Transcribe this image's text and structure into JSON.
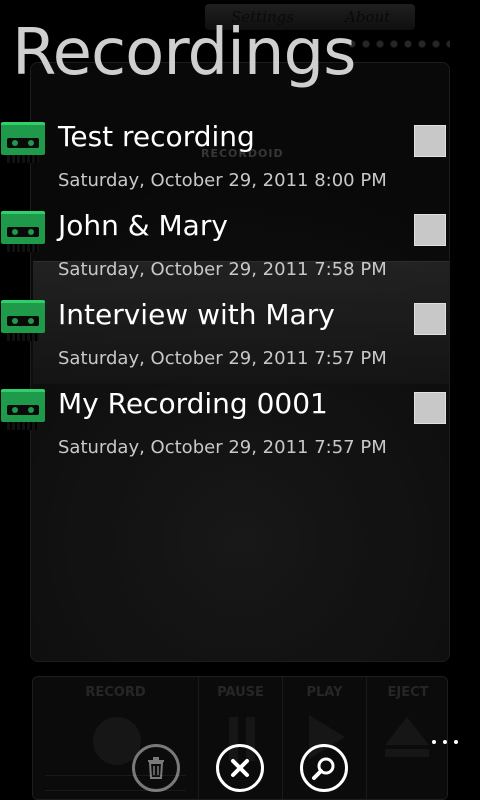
{
  "page": {
    "title": "Recordings"
  },
  "background": {
    "tabs": [
      "Settings",
      "About"
    ],
    "brand": "RECORDOID",
    "controls": [
      "RECORD",
      "PAUSE",
      "PLAY",
      "EJECT"
    ]
  },
  "recordings": [
    {
      "title": "Test recording",
      "date": "Saturday, October 29, 2011 8:00 PM"
    },
    {
      "title": "John & Mary",
      "date": "Saturday, October 29, 2011 7:58 PM"
    },
    {
      "title": "Interview with Mary",
      "date": "Saturday, October 29, 2011 7:57 PM"
    },
    {
      "title": "My Recording 0001",
      "date": "Saturday, October 29, 2011 7:57 PM"
    }
  ],
  "colors": {
    "accent": "#1f9a4a",
    "checkbox": "#c8c8c8",
    "title": "#cfcfcf"
  },
  "appbar": {
    "buttons": [
      {
        "icon": "trash-icon",
        "enabled": false
      },
      {
        "icon": "close-icon",
        "enabled": true
      },
      {
        "icon": "search-icon",
        "enabled": true
      }
    ],
    "more_icon": "ellipsis-icon"
  }
}
